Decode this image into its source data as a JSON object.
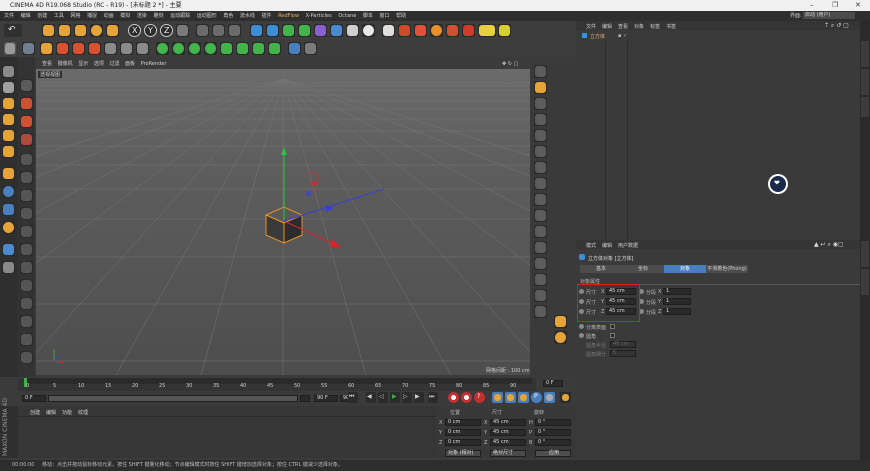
{
  "window": {
    "title": "CINEMA 4D R19.068 Studio (RC - R19) - [未标题 2 *] - 主要"
  },
  "menubar": {
    "items": [
      "文件",
      "编辑",
      "创建",
      "工具",
      "网格",
      "捕捉",
      "动画",
      "模拟",
      "渲染",
      "雕刻",
      "运动跟踪",
      "运动图形",
      "角色",
      "流水线",
      "插件",
      "RedFlow",
      "X-Particles",
      "Octane",
      "脚本",
      "窗口",
      "帮助"
    ],
    "highlight_index": 15,
    "layout_label": "界面:",
    "layout_value": "启动 (用户)"
  },
  "viewport": {
    "menu": [
      "查看",
      "摄像机",
      "显示",
      "选项",
      "过滤",
      "面板",
      "ProRender"
    ],
    "name": "透视视图",
    "grid_spacing": "网格间距 : 100 cm"
  },
  "timeline": {
    "ticks": [
      "0",
      "5",
      "10",
      "15",
      "20",
      "25",
      "30",
      "35",
      "40",
      "45",
      "50",
      "55",
      "60",
      "65",
      "70",
      "75",
      "80",
      "85",
      "90"
    ],
    "current_frame": "0 F",
    "start_field": "0 F",
    "end_field": "90 F",
    "range_start": "0 F",
    "range_end": "90 F"
  },
  "material_panel": {
    "menu": [
      "创建",
      "编辑",
      "功能",
      "纹理"
    ],
    "brand": "MAXON CINEMA 4D"
  },
  "coordinates": {
    "headers": [
      "位置",
      "尺寸",
      "旋转"
    ],
    "rows": [
      {
        "axis": "X",
        "pos": "0 cm",
        "size_axis": "X",
        "size": "45 cm",
        "rot_axis": "H",
        "rot": "0 °"
      },
      {
        "axis": "Y",
        "pos": "0 cm",
        "size_axis": "Y",
        "size": "45 cm",
        "rot_axis": "P",
        "rot": "0 °"
      },
      {
        "axis": "Z",
        "pos": "0 cm",
        "size_axis": "Z",
        "size": "45 cm",
        "rot_axis": "B",
        "rot": "0 °"
      }
    ],
    "mode_dropdown": "对象 (相对)",
    "size_dropdown": "绝对尺寸",
    "apply_button": "应用"
  },
  "object_manager": {
    "menu": [
      "文件",
      "编辑",
      "查看",
      "对象",
      "标签",
      "书签"
    ],
    "object_name": "立方体"
  },
  "attributes": {
    "menu": [
      "模式",
      "编辑",
      "用户数据"
    ],
    "title": "立方体对象 [立方体]",
    "tabs": [
      "基本",
      "坐标",
      "对象",
      "平滑着色(Phong)"
    ],
    "active_tab": 2,
    "section": "对象属性",
    "size_label": "尺寸",
    "size_axes": [
      "X",
      "Y",
      "Z"
    ],
    "sizes": [
      "45 cm",
      "45 cm",
      "45 cm"
    ],
    "segments_label": "分段",
    "segments": [
      "1",
      "1",
      "1"
    ],
    "separate_surfaces": "分离表面",
    "fillet": "圆角",
    "fillet_radius": "圆角半径",
    "fillet_subdivision": "圆角细分",
    "fillet_radius_value": "40 cm",
    "fillet_subdivision_value": "5"
  },
  "status": {
    "time": "00:00:00",
    "message": "移动：点击并拖动鼠标移动元素。按住 SHIFT 键量化移动；节点编辑模式时按住 SHIFT 键增加选择对象；按住 CTRL 键减少选择对象。"
  },
  "colors": {
    "accent": "#e8ad6a",
    "selection": "#d92020",
    "active_tab": "#4a7fbf",
    "axis_y": "#2ec04a",
    "axis_x": "#d8242c",
    "axis_z": "#3540d8"
  }
}
